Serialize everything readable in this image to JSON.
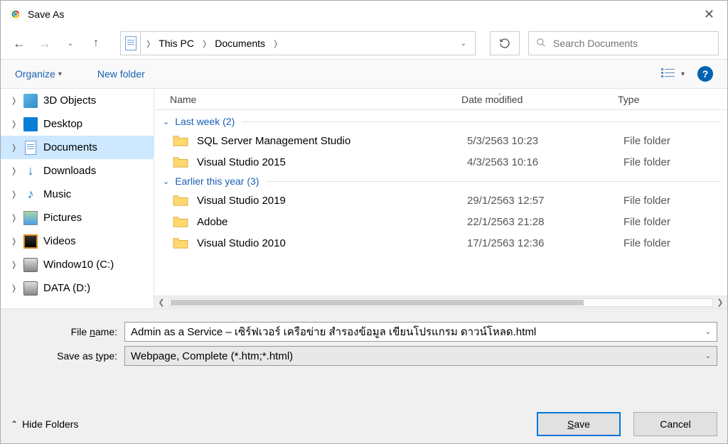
{
  "window": {
    "title": "Save As"
  },
  "breadcrumb": {
    "root": "This PC",
    "folder": "Documents"
  },
  "search": {
    "placeholder": "Search Documents"
  },
  "toolbar": {
    "organize": "Organize",
    "new_folder": "New folder"
  },
  "columns": {
    "name": "Name",
    "date": "Date modified",
    "type": "Type"
  },
  "sidebar": {
    "items": [
      {
        "label": "3D Objects",
        "icon": "3d"
      },
      {
        "label": "Desktop",
        "icon": "desktop"
      },
      {
        "label": "Documents",
        "icon": "doc",
        "selected": true
      },
      {
        "label": "Downloads",
        "icon": "downloads"
      },
      {
        "label": "Music",
        "icon": "music"
      },
      {
        "label": "Pictures",
        "icon": "pictures"
      },
      {
        "label": "Videos",
        "icon": "videos"
      },
      {
        "label": "Window10 (C:)",
        "icon": "drive"
      },
      {
        "label": "DATA (D:)",
        "icon": "drive"
      }
    ]
  },
  "groups": {
    "last_week": {
      "label": "Last week (2)"
    },
    "earlier_year": {
      "label": "Earlier this year (3)"
    }
  },
  "files": {
    "last_week": [
      {
        "name": "SQL Server Management Studio",
        "date": "5/3/2563 10:23",
        "type": "File folder"
      },
      {
        "name": "Visual Studio 2015",
        "date": "4/3/2563 10:16",
        "type": "File folder"
      }
    ],
    "earlier_year": [
      {
        "name": "Visual Studio 2019",
        "date": "29/1/2563 12:57",
        "type": "File folder"
      },
      {
        "name": "Adobe",
        "date": "22/1/2563 21:28",
        "type": "File folder"
      },
      {
        "name": "Visual Studio 2010",
        "date": "17/1/2563 12:36",
        "type": "File folder"
      }
    ]
  },
  "form": {
    "filename_label_pre": "File ",
    "filename_label_u": "n",
    "filename_label_post": "ame:",
    "filename_value": "Admin as a Service – เซิร์ฟเวอร์ เครือข่าย สำรองข้อมูล เขียนโปรแกรม ดาวน์โหลด.html",
    "type_label_pre": "Save as ",
    "type_label_u": "t",
    "type_label_post": "ype:",
    "type_value": "Webpage, Complete (*.htm;*.html)"
  },
  "footer": {
    "hide_folders": "Hide Folders",
    "save_u": "S",
    "save_post": "ave",
    "cancel": "Cancel"
  }
}
